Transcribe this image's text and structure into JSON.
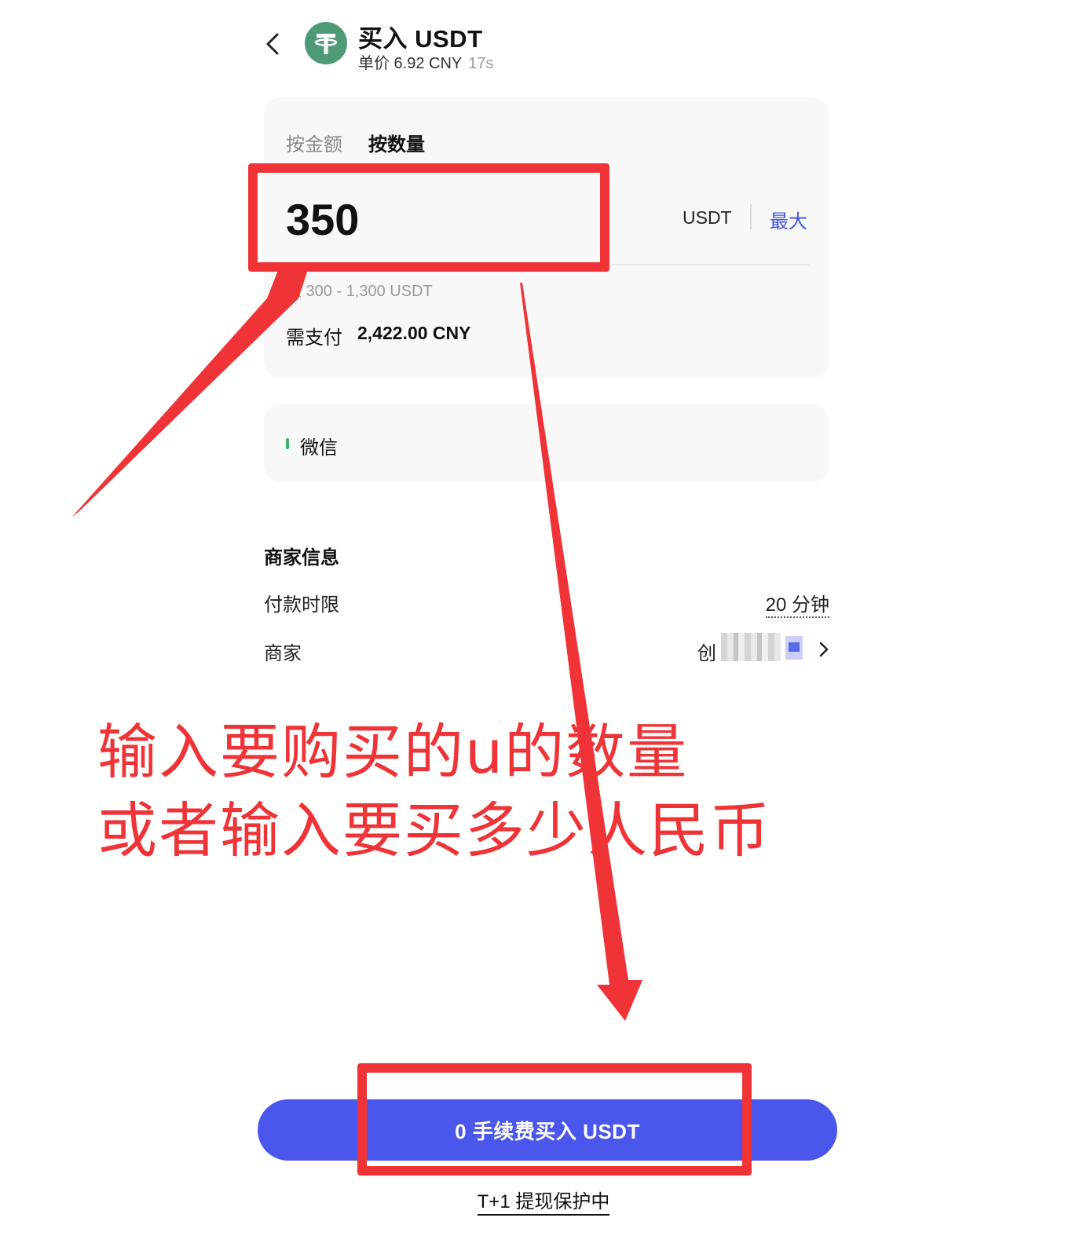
{
  "header": {
    "title": "买入 USDT",
    "price": "单价 6.92 CNY",
    "timer": "17s"
  },
  "order_card": {
    "tabs": [
      "按金额",
      "按数量"
    ],
    "active_tab": "按数量",
    "quantity": "350",
    "unit": "USDT",
    "max_label": "最大",
    "limit": "额 300 - 1,300 USDT",
    "pay_label": "需支付",
    "pay_amount": "2,422.00 CNY"
  },
  "payment_method": {
    "label": "微信"
  },
  "merchant_info": {
    "heading": "商家信息",
    "payment_time_label": "付款时限",
    "payment_time_value": "20 分钟",
    "merchant_label": "商家",
    "merchant_name_visible": "创"
  },
  "buy_button": {
    "label": "0 手续费买入 USDT"
  },
  "protection_link": "T+1 提现保护中",
  "annotations": {
    "line1": "输入要购买的u的数量",
    "line2": "或者输入要买多少人民币"
  },
  "colors": {
    "accent": "#4b56ec",
    "annotation": "#ef3336",
    "coin": "#4f9a76"
  }
}
